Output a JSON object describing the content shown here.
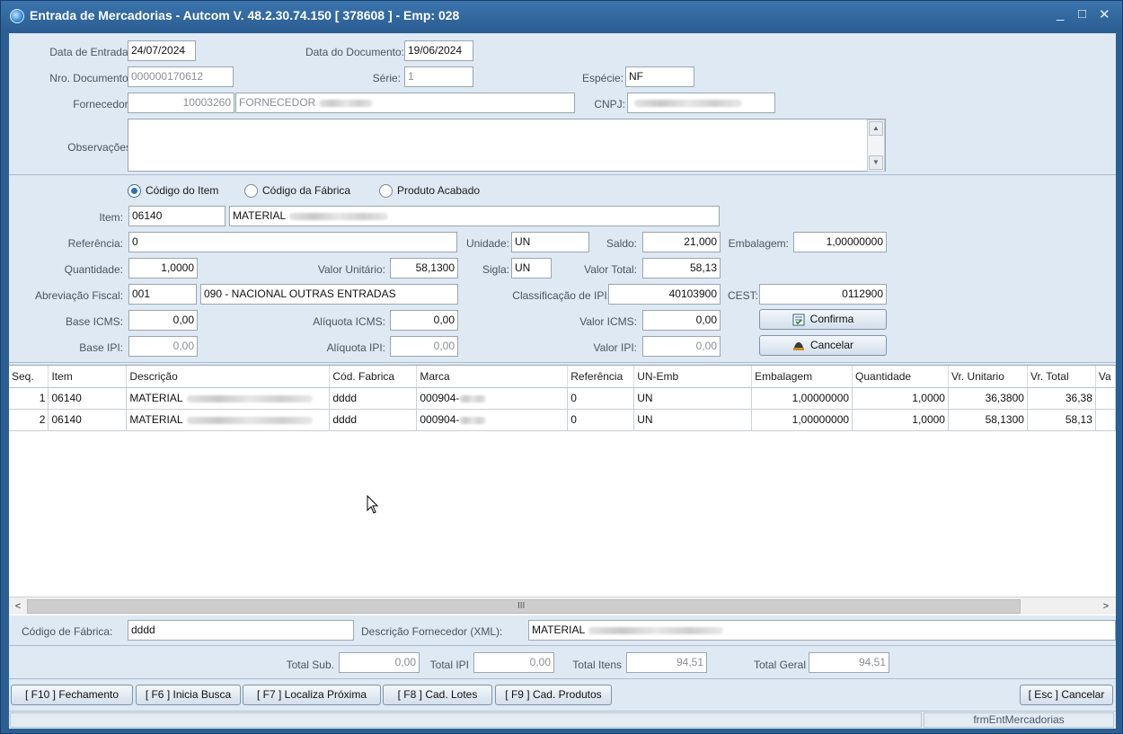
{
  "window": {
    "title": "Entrada de Mercadorias  -  Autcom V. 48.2.30.74.150 [ 378608 ] - Emp: 028",
    "controls": [
      "_",
      "□",
      "✕"
    ]
  },
  "header": {
    "data_entrada_label": "Data de Entrada:",
    "data_entrada": "24/07/2024",
    "data_documento_label": "Data do Documento:",
    "data_documento": "19/06/2024",
    "nro_documento_label": "Nro. Documento:",
    "nro_documento": "000000170612",
    "serie_label": "Série:",
    "serie": "1",
    "especie_label": "Espécie:",
    "especie": "NF",
    "fornecedor_label": "Fornecedor:",
    "fornecedor_codigo": "10003260",
    "fornecedor_nome": "FORNECEDOR",
    "cnpj_label": "CNPJ:",
    "observacoes_label": "Observações",
    "observacoes": ""
  },
  "item_form": {
    "radios": [
      {
        "label": "Código do Item",
        "checked": true
      },
      {
        "label": "Código da Fábrica",
        "checked": false
      },
      {
        "label": "Produto Acabado",
        "checked": false
      }
    ],
    "item_label": "Item:",
    "item_codigo": "06140",
    "item_descricao": "MATERIAL",
    "referencia_label": "Referência:",
    "referencia": "0",
    "unidade_label": "Unidade:",
    "unidade": "UN",
    "saldo_label": "Saldo:",
    "saldo": "21,000",
    "embalagem_label": "Embalagem:",
    "embalagem": "1,00000000",
    "quantidade_label": "Quantidade:",
    "quantidade": "1,0000",
    "valor_unitario_label": "Valor Unitário:",
    "valor_unitario": "58,1300",
    "sigla_label": "Sigla:",
    "sigla": "UN",
    "valor_total_label": "Valor Total:",
    "valor_total": "58,13",
    "abreviacao_fiscal_label": "Abreviação Fiscal:",
    "abreviacao_fiscal": "001",
    "abreviacao_fiscal_desc": "090 - NACIONAL OUTRAS ENTRADAS",
    "classificacao_ipi_label": "Classificação de IPI:",
    "classificacao_ipi": "40103900",
    "cest_label": "CEST:",
    "cest": "0112900",
    "base_icms_label": "Base ICMS:",
    "base_icms": "0,00",
    "aliquota_icms_label": "Alíquota ICMS:",
    "aliquota_icms": "0,00",
    "valor_icms_label": "Valor ICMS:",
    "valor_icms": "0,00",
    "base_ipi_label": "Base IPI:",
    "base_ipi": "0,00",
    "aliquota_ipi_label": "Alíquota IPI:",
    "aliquota_ipi": "0,00",
    "valor_ipi_label": "Valor IPI:",
    "valor_ipi": "0,00",
    "confirma_label": "Confirma",
    "cancelar_label": "Cancelar"
  },
  "grid": {
    "columns": [
      "Seq.",
      "Item",
      "Descrição",
      "Cód. Fabrica",
      "Marca",
      "Referência",
      "UN-Emb",
      "Embalagem",
      "Quantidade",
      "Vr. Unitario",
      "Vr. Total",
      "Va"
    ],
    "rows": [
      [
        "1",
        "06140",
        "MATERIAL",
        "dddd",
        "000904-",
        "0",
        "UN",
        "1,00000000",
        "1,0000",
        "36,3800",
        "36,38",
        ""
      ],
      [
        "2",
        "06140",
        "MATERIAL",
        "dddd",
        "000904-",
        "0",
        "UN",
        "1,00000000",
        "1,0000",
        "58,1300",
        "58,13",
        ""
      ]
    ],
    "scroll_grip": "III"
  },
  "footer": {
    "codigo_fabrica_label": "Código de Fábrica:",
    "codigo_fabrica": "dddd",
    "descricao_fornecedor_label": "Descrição Fornecedor (XML):",
    "descricao_fornecedor": "MATERIAL",
    "total_sub_label": "Total Sub.",
    "total_sub": "0,00",
    "total_ipi_label": "Total IPI",
    "total_ipi": "0,00",
    "total_itens_label": "Total Itens",
    "total_itens": "94,51",
    "total_geral_label": "Total Geral",
    "total_geral": "94,51"
  },
  "actions": {
    "fechamento": "[ F10 ] Fechamento",
    "inicia_busca": "[ F6 ] Inicia Busca",
    "localiza_proxima": "[ F7 ] Localiza Próxima",
    "cad_lotes": "[ F8 ] Cad. Lotes",
    "cad_produtos": "[ F9 ] Cad. Produtos",
    "cancelar": "[ Esc ] Cancelar"
  },
  "statusbar": {
    "form_name": "frmEntMercadorias"
  }
}
